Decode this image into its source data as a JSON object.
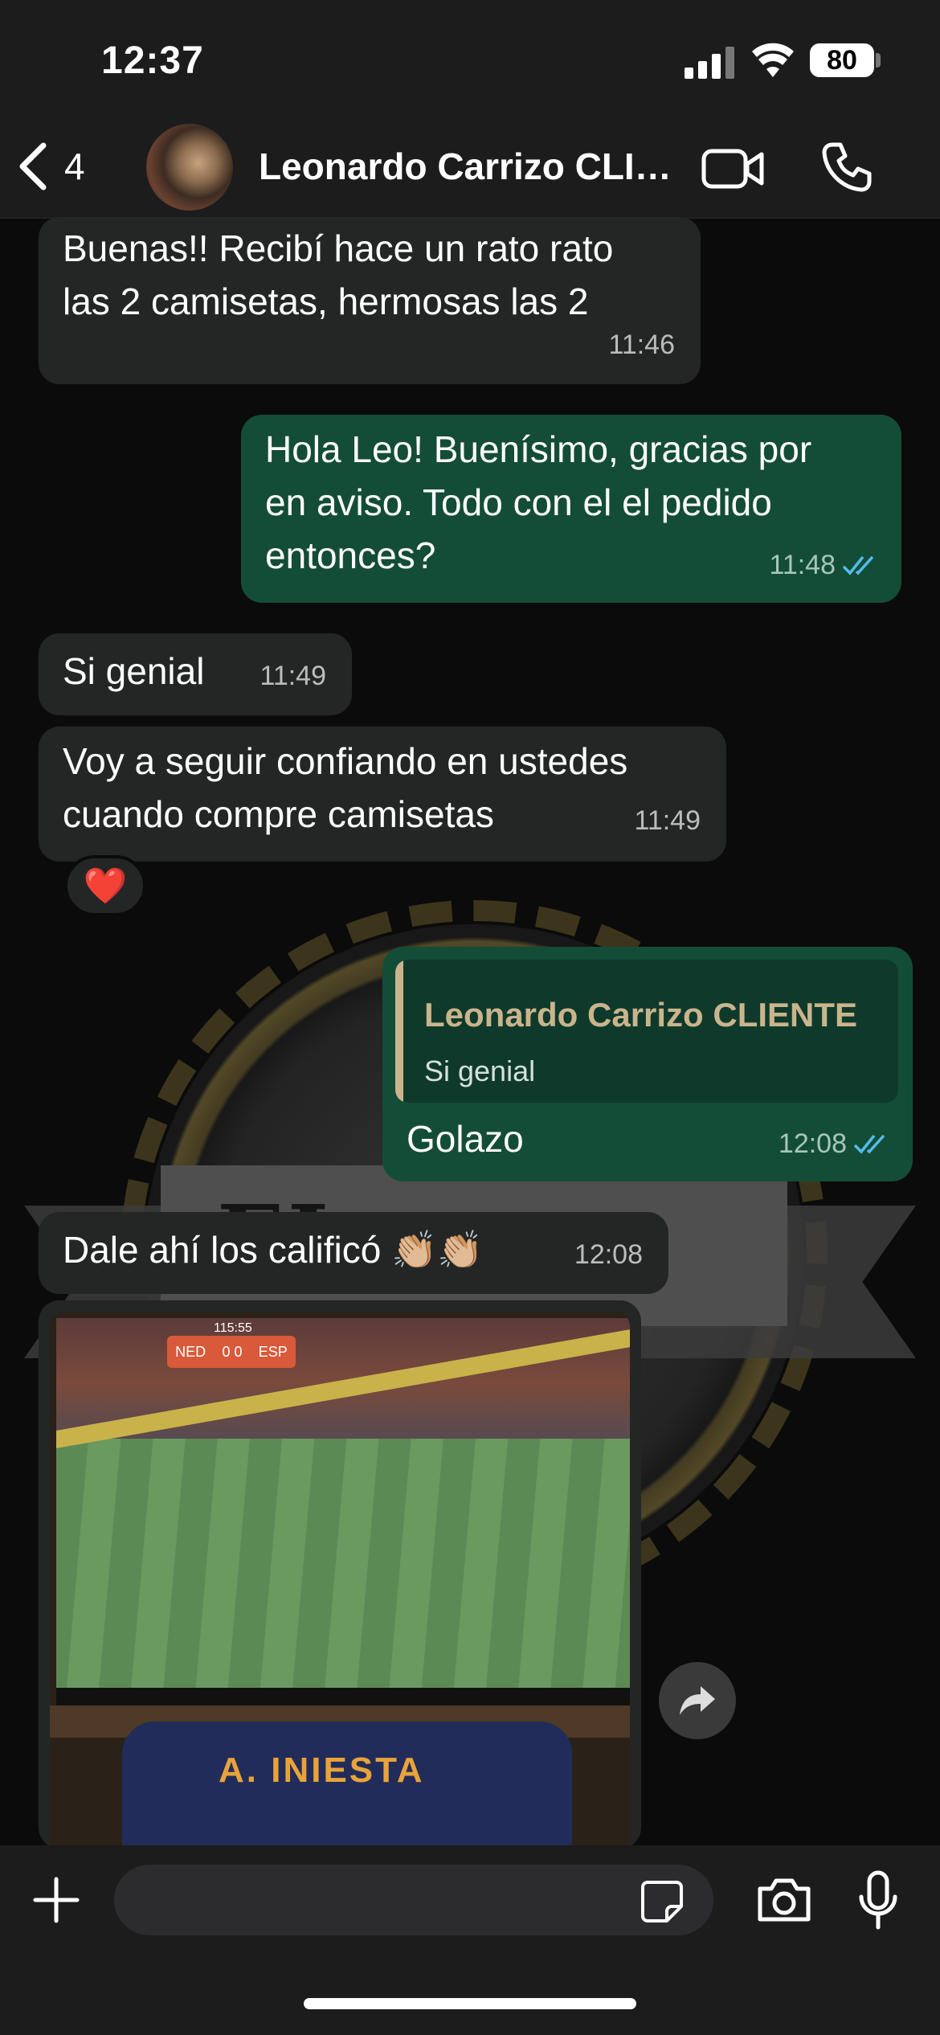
{
  "status_bar": {
    "time": "12:37",
    "battery": "80"
  },
  "header": {
    "back_count": "4",
    "contact_name": "Leonardo Carrizo CLIENTE"
  },
  "wallpaper": {
    "text": "EL "
  },
  "messages": [
    {
      "direction": "in",
      "lines": [
        "Buenas!! Recibí hace un rato rato",
        "las 2 camisetas, hermosas las 2"
      ],
      "time": "11:46"
    },
    {
      "direction": "out",
      "lines": [
        "Hola Leo! Buenísimo, gracias por",
        "en aviso. Todo con el el pedido",
        "entonces?"
      ],
      "time": "11:48",
      "read": true
    },
    {
      "direction": "in",
      "lines": [
        "Si genial"
      ],
      "time": "11:49"
    },
    {
      "direction": "in",
      "lines": [
        "Voy a seguir confiando en ustedes",
        "cuando compre camisetas"
      ],
      "time": "11:49",
      "reaction": "❤️"
    },
    {
      "direction": "out",
      "quote": {
        "author": "Leonardo Carrizo CLIENTE",
        "text": "Si genial"
      },
      "lines": [
        "Golazo"
      ],
      "time": "12:08",
      "read": true
    },
    {
      "direction": "in",
      "lines": [
        "Dale ahí los calificó 👏🏼👏🏼"
      ],
      "time": "12:08"
    }
  ],
  "photo": {
    "scoreboard_left": "NED",
    "scoreboard_score": "0 0",
    "scoreboard_right": "ESP",
    "scoreboard_clock": "115:55",
    "jersey_text": "A. INIESTA"
  },
  "input": {
    "placeholder": ""
  },
  "colors": {
    "incoming": "#242626",
    "outgoing": "#144d37",
    "read_tick": "#53bdeb",
    "quote_author": "#c9b48c"
  },
  "icons": [
    "chevron-left-icon",
    "video-call-icon",
    "phone-icon",
    "plus-icon",
    "sticker-icon",
    "camera-icon",
    "microphone-icon",
    "forward-icon",
    "double-check-icon"
  ]
}
